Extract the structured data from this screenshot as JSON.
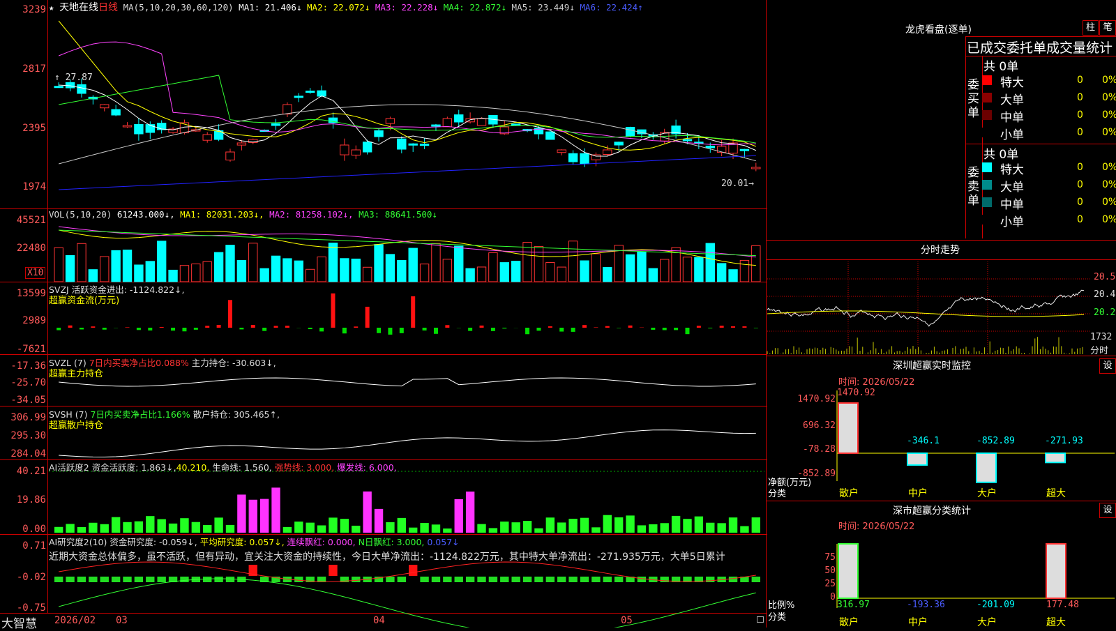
{
  "kline": {
    "star": "★",
    "name": "天地在线",
    "period": "日线",
    "ma_label": "MA(5,10,20,30,60,120)",
    "ma": [
      {
        "label": "MA1: 21.406↓",
        "color": "#ffffff"
      },
      {
        "label": "MA2: 22.072↓",
        "color": "#ffff00"
      },
      {
        "label": "MA3: 22.228↓",
        "color": "#ff44ff"
      },
      {
        "label": "MA4: 22.872↓",
        "color": "#33ff33"
      },
      {
        "label": "MA5: 23.449↓",
        "color": "#cccccc"
      },
      {
        "label": "MA6: 22.424↑",
        "color": "#4a5cff"
      }
    ],
    "y_ticks": [
      "3239",
      "2817",
      "2395",
      "1974"
    ],
    "high_label": "27.87",
    "low_label": "20.01"
  },
  "vol": {
    "header": "VOL(5,10,20)",
    "value": "61243.000↓,",
    "ma": [
      {
        "label": "MA1: 82031.203↓,",
        "color": "#ffff00"
      },
      {
        "label": "MA2: 81258.102↓,",
        "color": "#ff44ff"
      },
      {
        "label": "MA3: 88641.500↓",
        "color": "#33ff33"
      }
    ],
    "y_ticks": [
      "45521",
      "22480"
    ],
    "unit": "X10"
  },
  "svzj": {
    "line1": "SVZJ  活跃资金进出: -1124.822↓,",
    "line2": "超赢资金流(万元)",
    "y_ticks": [
      "13599",
      "2989",
      "-7621"
    ]
  },
  "svzl": {
    "prefix": "SVZL (7)",
    "text1": "7日内买卖净占比0.088%",
    "text2": "主力持仓: -30.603↓,",
    "line2": "超赢主力持仓",
    "y_ticks": [
      "-17.36",
      "-25.70",
      "-34.05"
    ]
  },
  "svsh": {
    "prefix": "SVSH (7)",
    "text1": "7日内买卖净占比1.166%",
    "text2": "散户持仓: 305.465↑,",
    "line2": "超赢散户持仓",
    "y_ticks": [
      "306.99",
      "295.30",
      "284.04"
    ]
  },
  "ai_active": {
    "p1": "AI活跃度2 资金活跃度: 1.863↓,",
    "p2": "40.210,",
    "p3": "生命线: 1.560,",
    "p4": "强势线: 3.000,",
    "p5": "爆发线: 6.000,",
    "y_ticks": [
      "40.21",
      "19.86",
      "0.00"
    ]
  },
  "ai_research": {
    "p1": "AI研究度2(10) 资金研究度: -0.059↓,",
    "p2": "平均研究度: 0.057↓,",
    "p3": "连续飘红: 0.000,",
    "p4": "N日飘红: 3.000,",
    "p5": "0.057↓",
    "note": "近期大资金总体偏多，虽不活跃，但有异动，宜关注大资金的持续性，今日大单净流出：-1124.822万元，其中特大单净流出：-271.935万元，大单5日累计",
    "y_ticks": [
      "0.71",
      "-0.02",
      "-0.75"
    ]
  },
  "bottom": {
    "brand": "大智慧",
    "dates": [
      "2026/02",
      "03",
      "04",
      "05"
    ]
  },
  "lhb": {
    "title": "龙虎看盘(逐单)",
    "btn1": "柱",
    "btn2": "笔",
    "subtitle": "已成交委托单成交量统计",
    "buy_label": "委买单",
    "sell_label": "委卖单",
    "buy_total": "共 0单",
    "sell_total": "共 0单",
    "buy_rows": [
      {
        "name": "特大",
        "count": "0",
        "pct": "0%",
        "color": "#ff0000"
      },
      {
        "name": "大单",
        "count": "0",
        "pct": "0%",
        "color": "#8b0000"
      },
      {
        "name": "中单",
        "count": "0",
        "pct": "0%",
        "color": "#6b0000"
      },
      {
        "name": "小单",
        "count": "0",
        "pct": "0%",
        "color": "#000000"
      }
    ],
    "sell_rows": [
      {
        "name": "特大",
        "count": "0",
        "pct": "0%",
        "color": "#00ffff"
      },
      {
        "name": "大单",
        "count": "0",
        "pct": "0%",
        "color": "#008b8b"
      },
      {
        "name": "中单",
        "count": "0",
        "pct": "0%",
        "color": "#006b6b"
      },
      {
        "name": "小单",
        "count": "0",
        "pct": "0%",
        "color": "#000000"
      }
    ]
  },
  "fenshi": {
    "title": "分时走势",
    "right_ticks": [
      "20.5",
      "20.4",
      "20.2"
    ],
    "vol_tick": "1732",
    "vol_label": "分时"
  },
  "sz_monitor": {
    "title": "深圳超赢实时监控",
    "btn": "设",
    "time": "时间: 2026/05/22",
    "y_ticks": [
      "1470.92",
      "696.32",
      "-78.28",
      "-852.89"
    ],
    "ylabel": "净额(万元)",
    "xlabel": "分类",
    "categories": [
      "散户",
      "中户",
      "大户",
      "超大"
    ],
    "values": [
      1470.92,
      -346.1,
      -852.89,
      -271.93
    ],
    "value_labels": [
      "1470.92",
      "-346.1",
      "-852.89",
      "-271.93"
    ]
  },
  "sz_class": {
    "title": "深市超赢分类统计",
    "btn": "设",
    "time": "时间: 2026/05/22",
    "y_ticks": [
      "75",
      "50",
      "25",
      "0"
    ],
    "ylabel": "比例%",
    "xlabel": "分类",
    "categories": [
      "散户",
      "中户",
      "大户",
      "超大"
    ],
    "value_labels": [
      "316.97",
      "-193.36",
      "-201.09",
      "177.48"
    ]
  }
}
